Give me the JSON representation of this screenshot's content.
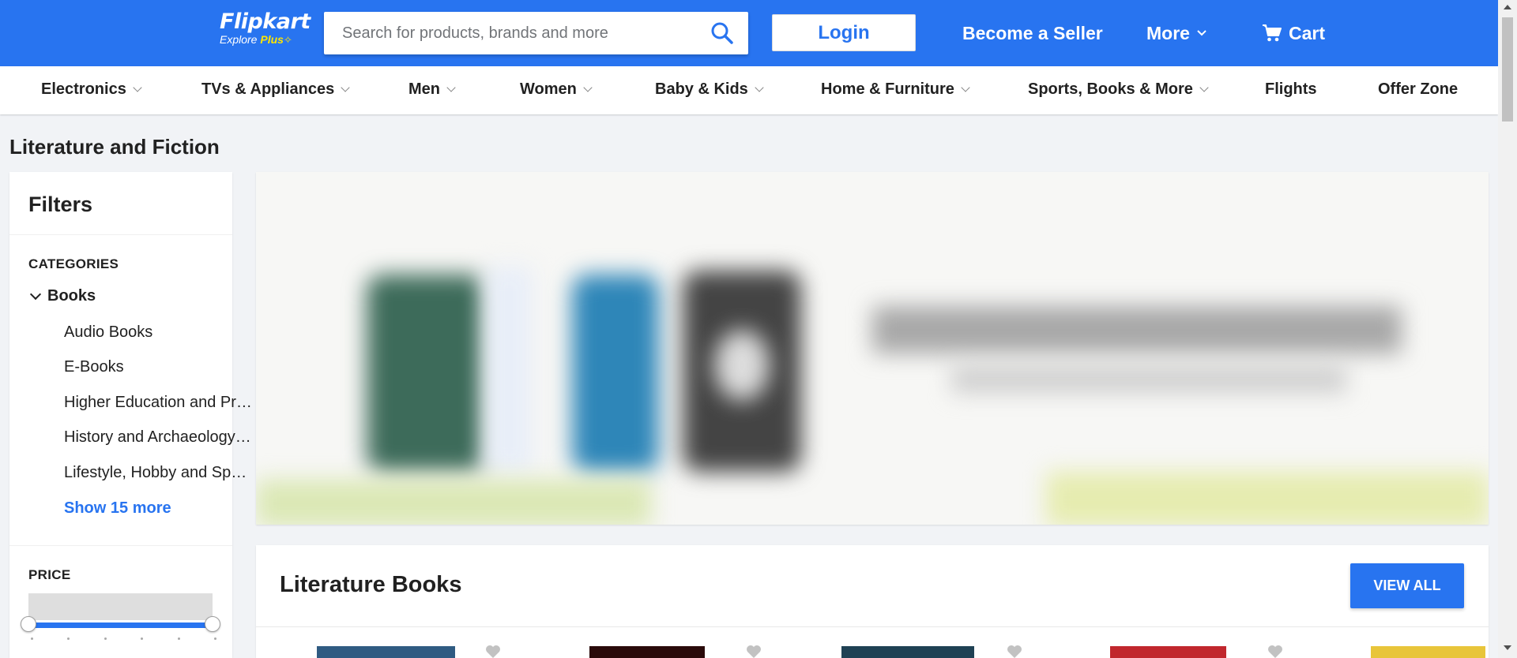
{
  "header": {
    "logo_text": "Flipkart",
    "logo_sub_explore": "Explore",
    "logo_sub_plus": "Plus",
    "search_placeholder": "Search for products, brands and more",
    "login_label": "Login",
    "seller_label": "Become a Seller",
    "more_label": "More",
    "cart_label": "Cart",
    "brand_color": "#2874f0",
    "accent_color": "#ffe500"
  },
  "nav": {
    "items": [
      {
        "label": "Electronics",
        "has_dropdown": true
      },
      {
        "label": "TVs & Appliances",
        "has_dropdown": true
      },
      {
        "label": "Men",
        "has_dropdown": true
      },
      {
        "label": "Women",
        "has_dropdown": true
      },
      {
        "label": "Baby & Kids",
        "has_dropdown": true
      },
      {
        "label": "Home & Furniture",
        "has_dropdown": true
      },
      {
        "label": "Sports, Books & More",
        "has_dropdown": true
      },
      {
        "label": "Flights",
        "has_dropdown": false
      },
      {
        "label": "Offer Zone",
        "has_dropdown": false
      }
    ]
  },
  "page": {
    "title": "Literature and Fiction"
  },
  "filters": {
    "title": "Filters",
    "categories_heading": "CATEGORIES",
    "parent_category": "Books",
    "subcategories": [
      "Audio Books",
      "E-Books",
      "Higher Education and Professional Books",
      "History and Archaeology Books",
      "Lifestyle, Hobby and Sport Books"
    ],
    "show_more": "Show 15 more",
    "price_heading": "PRICE"
  },
  "section": {
    "title": "Literature Books",
    "view_all_label": "VIEW ALL"
  },
  "icons": {
    "search": "search-icon",
    "cart": "cart-icon",
    "chevron": "chevron-down-icon",
    "heart": "heart-icon"
  }
}
